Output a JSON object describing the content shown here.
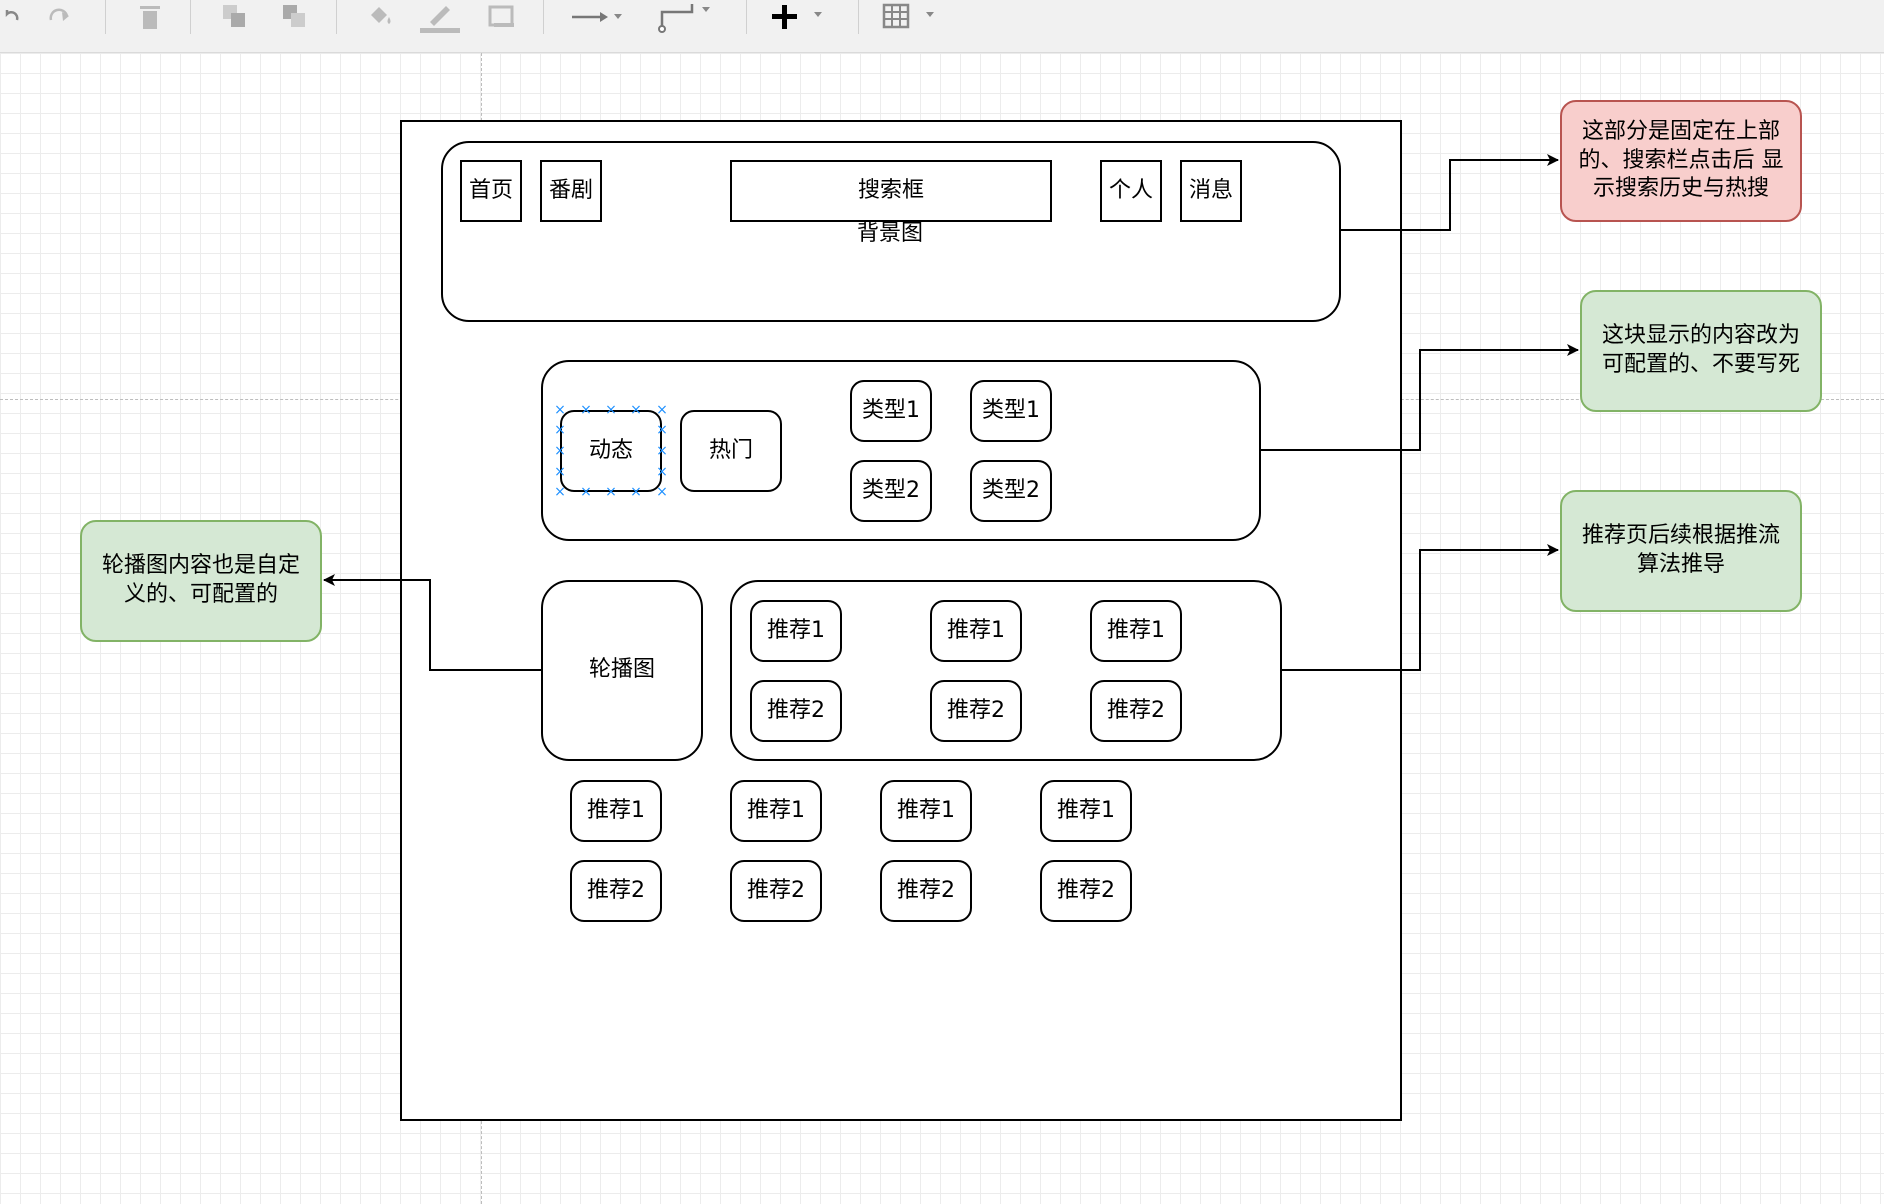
{
  "toolbar": {
    "icons": [
      "undo-icon",
      "redo-icon",
      "delete-icon",
      "to-front-icon",
      "to-back-icon",
      "fill-color-icon",
      "line-color-icon",
      "shadow-icon",
      "connection-icon",
      "waypoints-icon",
      "insert-icon",
      "table-icon"
    ]
  },
  "header": {
    "nav_home": "首页",
    "nav_anime": "番剧",
    "search": "搜索框",
    "background_label": "背景图",
    "profile": "个人",
    "messages": "消息"
  },
  "categories": {
    "dynamic": "动态",
    "hot": "热门",
    "type1": "类型1",
    "type2": "类型2"
  },
  "carousel": {
    "label": "轮播图"
  },
  "recommend": {
    "item1": "推荐1",
    "item2": "推荐2"
  },
  "notes": {
    "header_note": "这部分是固定在上部的、搜索栏点击后 显示搜索历史与热搜",
    "category_note": "这块显示的内容改为可配置的、不要写死",
    "recommend_note": "推荐页后续根据推流算法推导",
    "carousel_note": "轮播图内容也是自定义的、可配置的"
  },
  "colors": {
    "note_red_fill": "#f8cecc",
    "note_red_border": "#b85450",
    "note_green_fill": "#d5e8d4",
    "note_green_border": "#82b366",
    "selection_handle": "#1e90ff"
  }
}
